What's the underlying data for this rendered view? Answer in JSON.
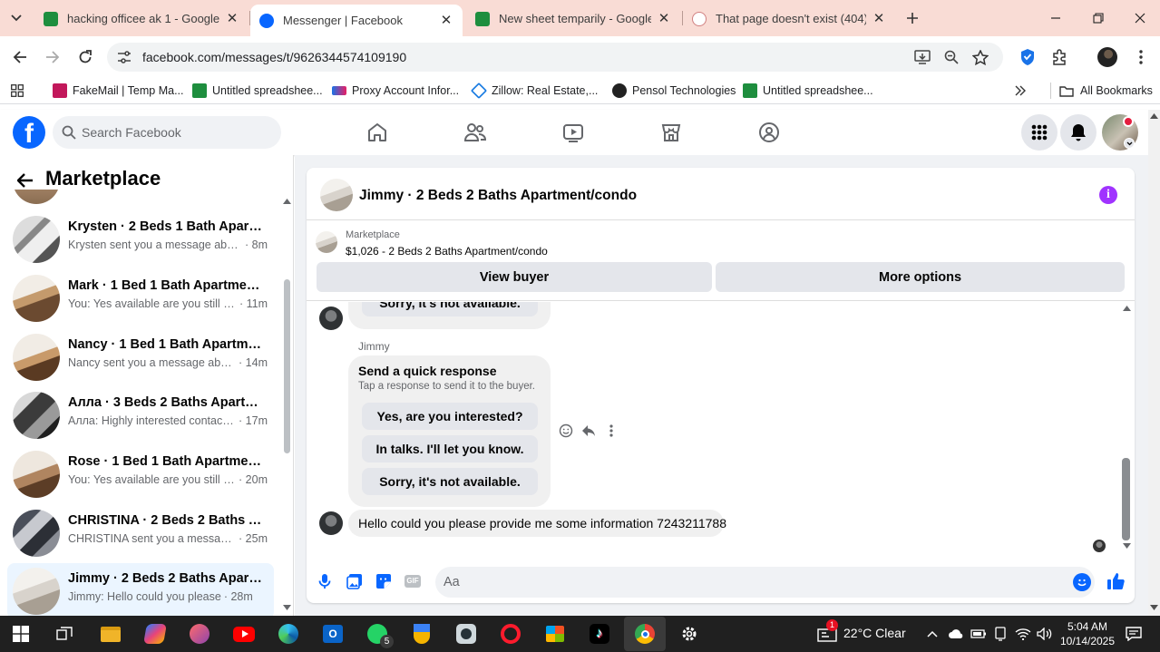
{
  "browser": {
    "tabs": [
      {
        "title": "hacking officee ak 1 - Google Sh",
        "favicon": "sheets",
        "active": false
      },
      {
        "title": "Messenger | Facebook",
        "favicon": "facebook",
        "active": true
      },
      {
        "title": "New sheet temparily - Google Sh",
        "favicon": "sheets",
        "active": false
      },
      {
        "title": "That page doesn't exist (404) - F",
        "favicon": "page",
        "active": false
      }
    ],
    "url": "facebook.com/messages/t/9626344574109190",
    "bookmarks": [
      {
        "label": "FakeMail | Temp Ma...",
        "icon": "fakemail"
      },
      {
        "label": "Untitled spreadshee...",
        "icon": "sheets"
      },
      {
        "label": "Proxy Account Infor...",
        "icon": "proxy"
      },
      {
        "label": "Zillow: Real Estate,...",
        "icon": "zillow"
      },
      {
        "label": "Pensol Technologies",
        "icon": "pensol"
      },
      {
        "label": "Untitled spreadshee...",
        "icon": "sheets"
      }
    ],
    "all_bookmarks": "All Bookmarks",
    "colors": {
      "tabstrip": "#f9dcd5",
      "fb_blue": "#0866ff",
      "accent_purple": "#a033ff"
    }
  },
  "facebook": {
    "search_placeholder": "Search Facebook"
  },
  "marketplace": {
    "title": "Marketplace",
    "conversations": [
      {
        "name": "Krysten · 2 Beds 1 Bath Apartment/condo",
        "preview": "Krysten sent you a message about...",
        "time": "· 8m"
      },
      {
        "name": "Mark · 1 Bed 1 Bath Apartment/condo",
        "preview": "You: Yes available are you still int...",
        "time": "· 11m"
      },
      {
        "name": "Nancy · 1 Bed 1 Bath Apartment/condo",
        "preview": "Nancy sent you a message about...",
        "time": "· 14m"
      },
      {
        "name": "Алла · 3 Beds 2 Baths Apartment/condo",
        "preview": "Алла: Highly interested contact ...",
        "time": "· 17m"
      },
      {
        "name": "Rose · 1 Bed 1 Bath Apartment/condo",
        "preview": "You: Yes available are you still int...",
        "time": "· 20m"
      },
      {
        "name": "CHRISTINA · 2 Beds 2 Baths Apartment/condo",
        "preview": "CHRISTINA sent you a message a...",
        "time": "· 25m"
      },
      {
        "name": "Jimmy · 2 Beds 2 Baths Apartment/condo",
        "preview": "Jimmy: Hello could you please",
        "time": "· 28m"
      }
    ]
  },
  "chat": {
    "title": "Jimmy · 2 Beds 2 Baths Apartment/condo",
    "listing_label": "Marketplace",
    "listing_item": "$1,026 - 2 Beds 2 Baths Apartment/condo",
    "view_buyer": "View buyer",
    "more_options": "More options",
    "prev_option": "Sorry, it's not available.",
    "sender": "Jimmy",
    "quick_title": "Send a quick response",
    "quick_sub": "Tap a response to send it to the buyer.",
    "quick_options": [
      "Yes, are you interested?",
      "In talks. I'll let you know.",
      "Sorry, it's not available."
    ],
    "last_message": "Hello could you please provide me some information 7243211788",
    "composer_placeholder": "Aa"
  },
  "taskbar": {
    "whatsapp_badge": "5",
    "weather_badge": "1",
    "weather": "22°C  Clear",
    "time": "5:04 AM",
    "date": "10/14/2025"
  }
}
